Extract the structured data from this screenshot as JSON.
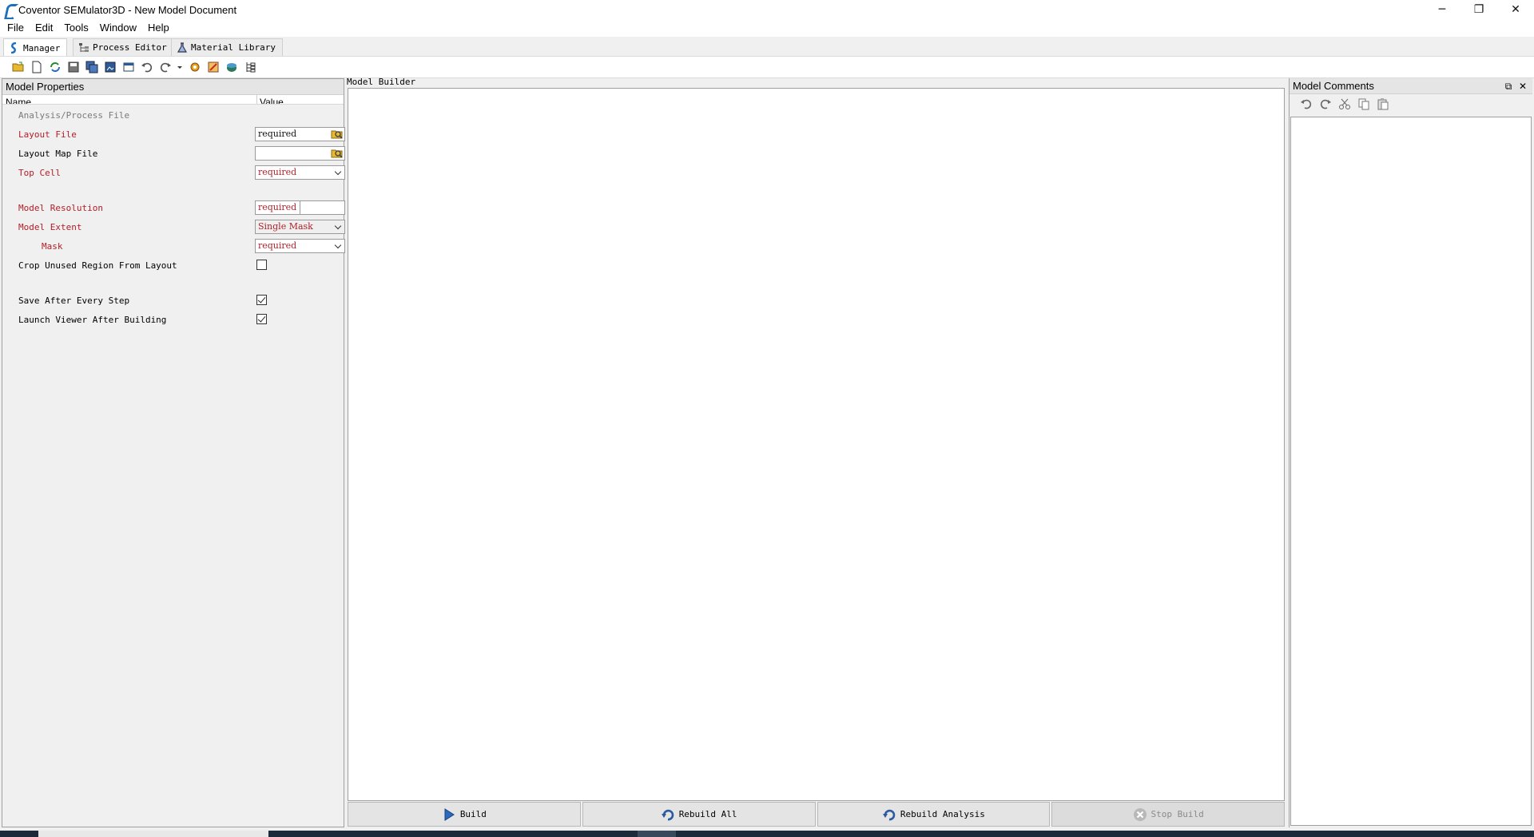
{
  "window": {
    "title": "Coventor SEMulator3D - New Model Document",
    "minimize_glyph": "─",
    "restore_glyph": "❐",
    "close_glyph": "✕"
  },
  "menu": {
    "items": [
      {
        "label": "File",
        "accel": "F"
      },
      {
        "label": "Edit",
        "accel": "E"
      },
      {
        "label": "Tools",
        "accel": "T"
      },
      {
        "label": "Window",
        "accel": "W"
      },
      {
        "label": "Help",
        "accel": "H"
      }
    ]
  },
  "tabs": [
    {
      "label": "Manager",
      "icon": "semulator-icon",
      "active": true
    },
    {
      "label": "Process Editor",
      "icon": "process-tree-icon",
      "active": false
    },
    {
      "label": "Material Library",
      "icon": "flask-icon",
      "active": false
    }
  ],
  "toolbar": {
    "icons": [
      "open-folder-icon",
      "new-document-icon",
      "refresh-icon",
      "save-icon",
      "save-all-icon",
      "save-image-icon",
      "export-icon",
      "undo-icon",
      "redo-icon",
      "dropdown-arrow-icon",
      "build-settings-icon",
      "layout-icon",
      "viewer-icon",
      "hierarchy-icon"
    ]
  },
  "model_properties": {
    "title": "Model Properties",
    "col_name": "Name",
    "col_value": "Value",
    "rows": {
      "analysis_process": {
        "label": "Analysis/Process File"
      },
      "layout_file": {
        "label": "Layout File",
        "value": "required"
      },
      "layout_map_file": {
        "label": "Layout Map File",
        "value": ""
      },
      "top_cell": {
        "label": "Top Cell",
        "value": "required"
      },
      "model_resolution": {
        "label": "Model Resolution",
        "value": "required"
      },
      "model_extent": {
        "label": "Model Extent",
        "value": "Single Mask"
      },
      "mask": {
        "label": "Mask",
        "value": "required"
      },
      "crop_unused": {
        "label": "Crop Unused Region From Layout",
        "checked": false
      },
      "save_after_step": {
        "label": "Save After Every Step",
        "checked": true
      },
      "launch_viewer": {
        "label": "Launch Viewer After Building",
        "checked": true
      }
    }
  },
  "model_builder": {
    "title": "Model Builder",
    "buttons": {
      "build": "Build",
      "rebuild_all": "Rebuild All",
      "rebuild_analysis": "Rebuild Analysis",
      "stop_build": "Stop Build"
    }
  },
  "model_comments": {
    "title": "Model Comments",
    "float_glyph": "⧉",
    "close_glyph": "✕"
  },
  "colors": {
    "required_text": "#b0202a",
    "accent_blue": "#1f6fbf"
  }
}
